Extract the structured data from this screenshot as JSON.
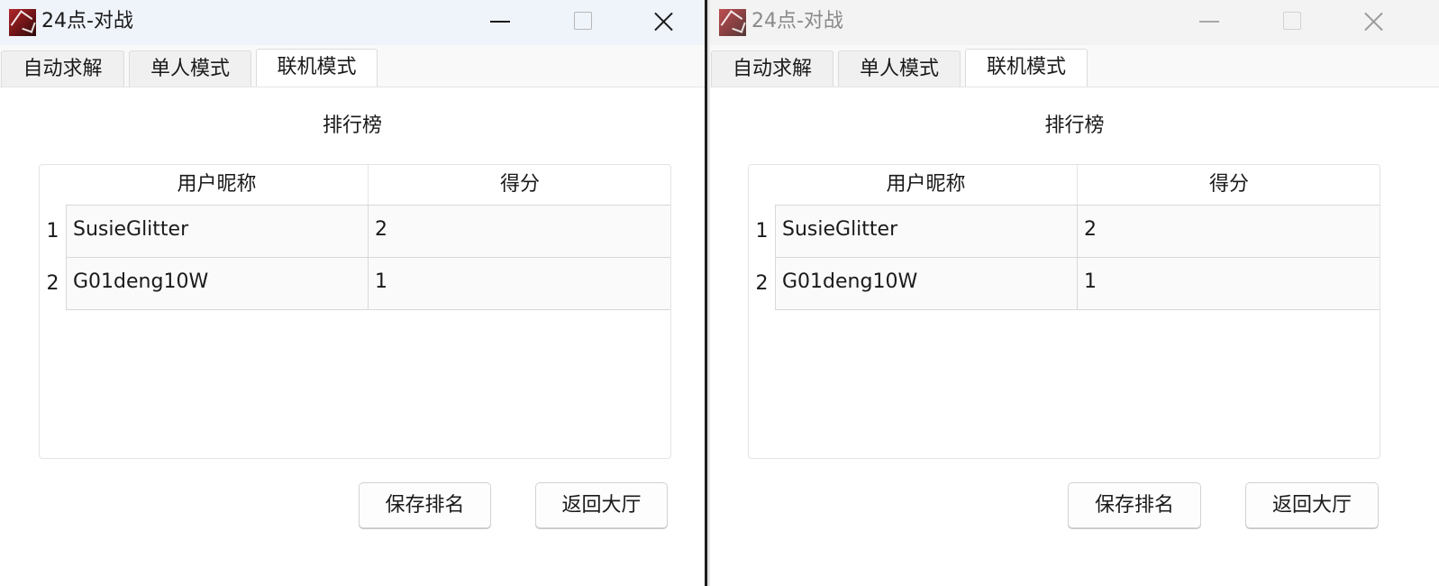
{
  "windows": [
    {
      "title": "24点-对战",
      "tabs": [
        "自动求解",
        "单人模式",
        "联机模式"
      ],
      "active_tab": "联机模式",
      "heading": "排行榜",
      "table": {
        "columns": [
          "用户昵称",
          "得分"
        ],
        "rows": [
          {
            "index": "1",
            "name": "SusieGlitter",
            "score": "2"
          },
          {
            "index": "2",
            "name": "G01deng10W",
            "score": "1"
          }
        ]
      },
      "buttons": {
        "save": "保存排名",
        "back": "返回大厅"
      },
      "icons": {
        "app": "poker-card-app-icon",
        "minimize": "minimize-icon",
        "maximize": "maximize-icon",
        "close": "close-icon"
      }
    },
    {
      "title": "24点-对战",
      "tabs": [
        "自动求解",
        "单人模式",
        "联机模式"
      ],
      "active_tab": "联机模式",
      "heading": "排行榜",
      "table": {
        "columns": [
          "用户昵称",
          "得分"
        ],
        "rows": [
          {
            "index": "1",
            "name": "SusieGlitter",
            "score": "2"
          },
          {
            "index": "2",
            "name": "G01deng10W",
            "score": "1"
          }
        ]
      },
      "buttons": {
        "save": "保存排名",
        "back": "返回大厅"
      },
      "icons": {
        "app": "poker-card-app-icon",
        "minimize": "minimize-icon",
        "maximize": "maximize-icon",
        "close": "close-icon"
      }
    }
  ]
}
